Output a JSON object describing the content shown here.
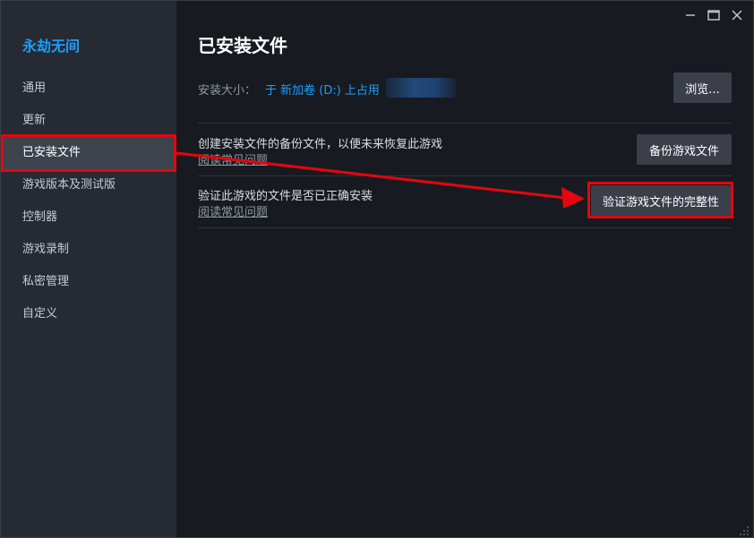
{
  "sidebar": {
    "game_title": "永劫无间",
    "items": [
      {
        "label": "通用"
      },
      {
        "label": "更新"
      },
      {
        "label": "已安装文件"
      },
      {
        "label": "游戏版本及测试版"
      },
      {
        "label": "控制器"
      },
      {
        "label": "游戏录制"
      },
      {
        "label": "私密管理"
      },
      {
        "label": "自定义"
      }
    ]
  },
  "main": {
    "title": "已安装文件",
    "install_size_label": "安装大小：",
    "install_size_value": "于 新加卷 (D:) 上占用",
    "browse_label": "浏览...",
    "backup": {
      "text": "创建安装文件的备份文件，以便未来恢复此游戏",
      "link": "阅读常见问题",
      "button": "备份游戏文件"
    },
    "verify": {
      "text": "验证此游戏的文件是否已正确安装",
      "link": "阅读常见问题",
      "button": "验证游戏文件的完整性"
    }
  },
  "window_controls": {
    "minimize_icon": "minimize-icon",
    "maximize_icon": "maximize-icon",
    "close_icon": "close-icon"
  },
  "colors": {
    "accent": "#1a9fff",
    "highlight": "#e6050d",
    "sidebar_bg": "#262a33",
    "main_bg": "#171b21"
  }
}
